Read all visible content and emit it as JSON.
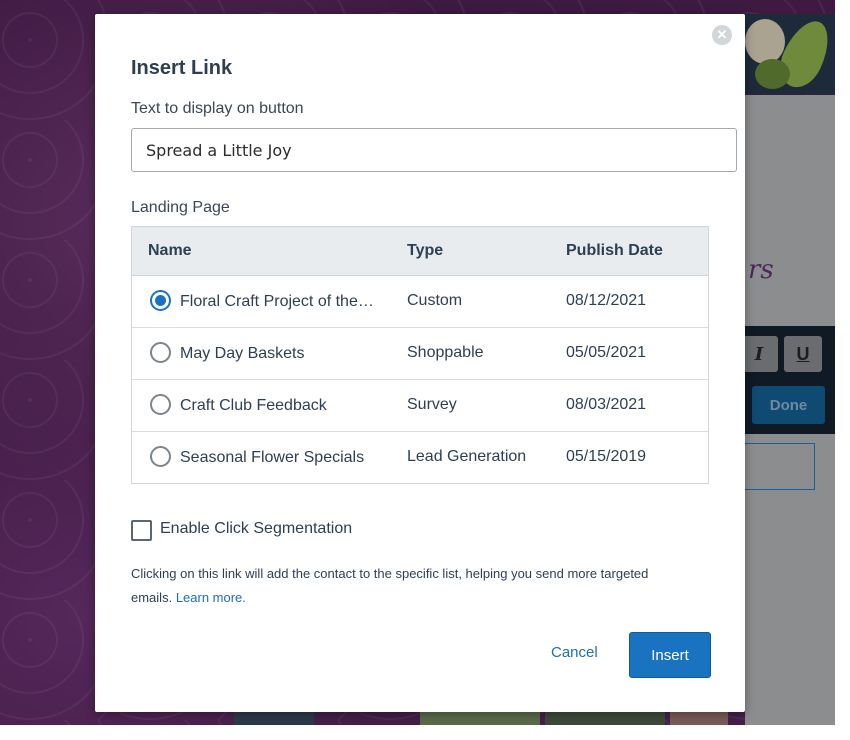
{
  "background": {
    "toolbar": {
      "italic_label": "I",
      "underline_label": "U",
      "done_label": "Done"
    },
    "script_text": "rs"
  },
  "dialog": {
    "title": "Insert Link",
    "close_icon": "close-icon",
    "text_field": {
      "label": "Text to display on button",
      "value": "Spread a Little Joy"
    },
    "landing_page": {
      "label": "Landing Page",
      "columns": [
        "Name",
        "Type",
        "Publish Date"
      ],
      "rows": [
        {
          "name": "Floral Craft Project of the Month",
          "type": "Custom",
          "date": "08/12/2021",
          "selected": true
        },
        {
          "name": "May Day Baskets",
          "type": "Shoppable",
          "date": "05/05/2021",
          "selected": false
        },
        {
          "name": "Craft Club Feedback",
          "type": "Survey",
          "date": "08/03/2021",
          "selected": false
        },
        {
          "name": "Seasonal Flower Specials",
          "type": "Lead Generation",
          "date": "05/15/2019",
          "selected": false
        }
      ]
    },
    "segmentation": {
      "label": "Enable Click Segmentation",
      "checked": false,
      "help_text": "Clicking on this link will add the contact to the specific list, helping you send more targeted emails.",
      "learn_more": "Learn more."
    },
    "actions": {
      "cancel": "Cancel",
      "insert": "Insert"
    }
  },
  "colors": {
    "accent": "#1a73c1",
    "link": "#1a6fb5",
    "text": "#2e3f52",
    "header_bg": "#e8ecef",
    "backdrop": "#3e1a42"
  }
}
